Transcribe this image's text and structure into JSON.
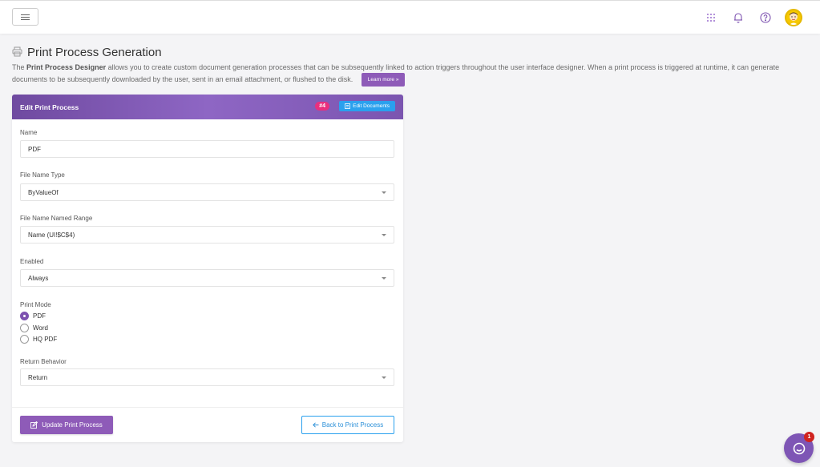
{
  "header": {
    "title": "Print Process Generation",
    "desc_bold": "Print Process Designer",
    "desc_rest": "allows you to create custom document generation processes that can be subsequently linked to action triggers throughout the user interface designer. When a print process is triggered at runtime, it can generate documents to be subsequently downloaded by the user, sent in an email attachment, or flushed to the disk.",
    "desc_prefix": "The",
    "learn_more": "Learn more »"
  },
  "card": {
    "title": "Edit Print Process",
    "badge": "#4",
    "edit_documents": "Edit Documents"
  },
  "form": {
    "name_label": "Name",
    "name_value": "PDF",
    "file_name_type_label": "File Name Type",
    "file_name_type_value": "ByValueOf",
    "file_name_range_label": "File Name Named Range",
    "file_name_range_value": "Name (UI!$C$4)",
    "enabled_label": "Enabled",
    "enabled_value": "Always",
    "print_mode_label": "Print Mode",
    "print_mode_options": [
      "PDF",
      "Word",
      "HQ PDF"
    ],
    "print_mode_selected": "PDF",
    "return_label": "Return Behavior",
    "return_value": "Return"
  },
  "buttons": {
    "update": "Update Print Process",
    "back": "Back to Print Process"
  },
  "chat": {
    "count": "1"
  },
  "colors": {
    "accent": "#8e5bb8",
    "header_gradient_start": "#6f4aa0",
    "info_blue": "#2aa0ee",
    "badge_pink": "#e9307e"
  }
}
